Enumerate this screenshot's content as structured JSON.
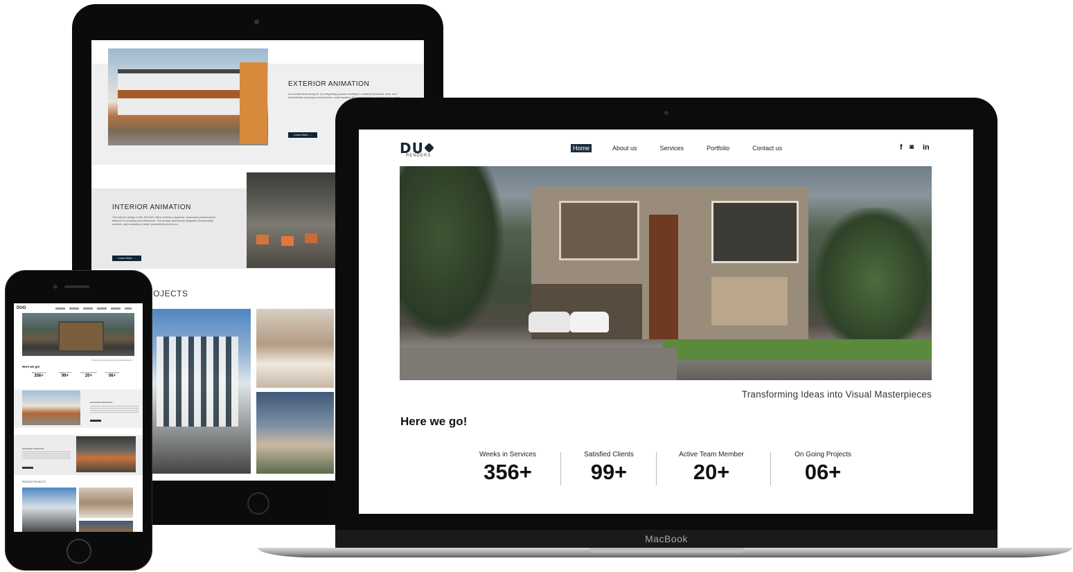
{
  "tablet": {
    "exterior": {
      "title": "EXTERIOR ANIMATION",
      "description": "An architectural designer, by integrating spaces resulting in creating functional, safe, and aesthetically pleasing environments, understanding the comprehensive needs of occupants.",
      "button": "Learn More →"
    },
    "interior": {
      "title": "INTERIOR ANIMATION",
      "description": "The interior design of the 3D DUO office reflects a dynamic, welcoming environment tailored for creativity and teamwork. The design seamlessly integrates functionality, comfort, and creativity to foster productivity and focus.",
      "button": "Learn More →"
    },
    "projects_title": "ROJECTS"
  },
  "phone": {
    "logo": "DUO",
    "tagline": "Transforming Ideas into Visual Masterpieces",
    "here": "Here we go!",
    "stats": [
      {
        "label": "Weeks in Services",
        "value": "356+"
      },
      {
        "label": "Satisfied Clients",
        "value": "99+"
      },
      {
        "label": "Active Team Member",
        "value": "20+"
      },
      {
        "label": "On Going Projects",
        "value": "06+"
      }
    ],
    "exterior_title": "EXTERIOR ANIMATION",
    "interior_title": "INTERIOR ANIMATION",
    "recent_projects": "RECENT PROJECTS"
  },
  "laptop": {
    "brand": "MacBook",
    "logo": {
      "text": "DU",
      "sub": "RENDERS"
    },
    "nav": [
      {
        "label": "Home",
        "active": true
      },
      {
        "label": "About us",
        "active": false
      },
      {
        "label": "Services",
        "active": false
      },
      {
        "label": "Portfolio",
        "active": false
      },
      {
        "label": "Contact us",
        "active": false
      }
    ],
    "social": {
      "facebook": "f",
      "instagram": "◙",
      "linkedin": "in"
    },
    "tagline": "Transforming Ideas into Visual Masterpieces",
    "heading": "Here we go!",
    "stats": [
      {
        "label": "Weeks in Services",
        "value": "356+"
      },
      {
        "label": "Satisfied Clients",
        "value": "99+"
      },
      {
        "label": "Active Team Member",
        "value": "20+"
      },
      {
        "label": "On Going Projects",
        "value": "06+"
      }
    ]
  },
  "icons": {
    "facebook": "facebook-icon",
    "instagram": "instagram-icon",
    "linkedin": "linkedin-icon"
  }
}
